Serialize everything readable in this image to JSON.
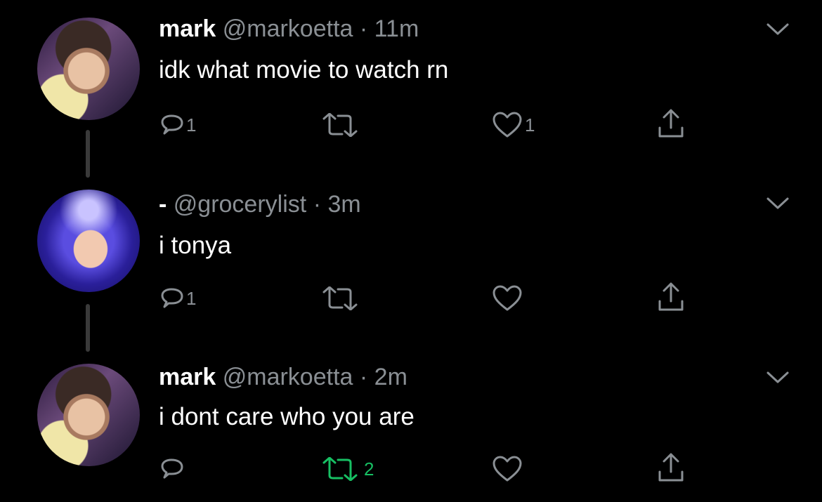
{
  "tweets": [
    {
      "name": "mark",
      "handle": "@markoetta",
      "dot": "·",
      "time": "11m",
      "text": "idk what movie to watch rn",
      "replies": "1",
      "retweets": "",
      "likes": "1",
      "retweeted": false
    },
    {
      "name": "-",
      "handle": "@grocerylist",
      "dot": "·",
      "time": "3m",
      "text": "i tonya",
      "replies": "1",
      "retweets": "",
      "likes": "",
      "retweeted": false
    },
    {
      "name": "mark",
      "handle": "@markoetta",
      "dot": "·",
      "time": "2m",
      "text": "i dont care who you are",
      "replies": "",
      "retweets": "2",
      "likes": "",
      "retweeted": true
    }
  ],
  "icons": {
    "reply": "reply-icon",
    "retweet": "retweet-icon",
    "like": "heart-icon",
    "share": "share-icon",
    "menu": "chevron-down-icon"
  },
  "colors": {
    "background": "#000000",
    "muted": "#8a8f94",
    "retweet_active": "#17bf63"
  }
}
